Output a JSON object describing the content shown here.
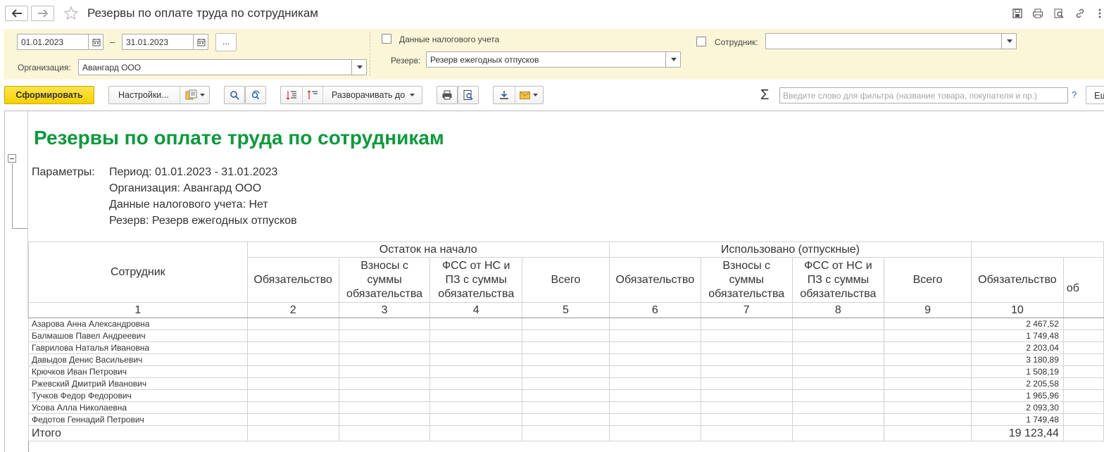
{
  "window": {
    "title": "Резервы по оплате труда по сотрудникам"
  },
  "settings": {
    "date_from": "01.01.2023",
    "date_to": "31.01.2023",
    "dash": "–",
    "dots_label": "...",
    "org_label": "Организация:",
    "org_value": "Авангард ООО",
    "tax_label": "Данные налогового учета",
    "tax_checked": false,
    "reserve_label": "Резерв:",
    "reserve_value": "Резерв ежегодных отпусков",
    "employee_label": "Сотрудник:",
    "employee_value": "",
    "employee_checked": false
  },
  "toolbar": {
    "generate": "Сформировать",
    "settings": "Настройки...",
    "expand": "Разворачивать до",
    "sigma": "Σ",
    "filter_placeholder": "Введите слово для фильтра (название товара, покупателя и пр.)",
    "help": "?",
    "eq": "Еще"
  },
  "report": {
    "title": "Резервы по оплате труда по сотрудникам",
    "params_label": "Параметры:",
    "params": [
      "Период: 01.01.2023 - 31.01.2023",
      "Организация: Авангард ООО",
      "Данные налогового учета: Нет",
      "Резерв: Резерв ежегодных отпусков"
    ],
    "columns": {
      "employee": "Сотрудник",
      "group1": "Остаток на начало",
      "group2": "Использовано (отпускные)",
      "group3": "",
      "sub": [
        "Обязательство",
        "Взносы с суммы обязательства",
        "ФСС от НС и ПЗ с суммы обязательства",
        "Всего",
        "Обязательство",
        "Взносы с суммы обязательства",
        "ФСС от НС и ПЗ с суммы обязательства",
        "Всего",
        "Обязательство",
        "об"
      ],
      "numbers": [
        "1",
        "2",
        "3",
        "4",
        "5",
        "6",
        "7",
        "8",
        "9",
        "10",
        ""
      ]
    },
    "rows": [
      {
        "name": "Азарова Анна Александровна",
        "c10": "2 467,52"
      },
      {
        "name": "Балмашов Павел Андреевич",
        "c10": "1 749,48"
      },
      {
        "name": "Гаврилова Наталья Ивановна",
        "c10": "2 203,04"
      },
      {
        "name": "Давыдов Денис Васильевич",
        "c10": "3 180,89"
      },
      {
        "name": "Крючков Иван Петрович",
        "c10": "1 508,19"
      },
      {
        "name": "Ржевский Дмитрий Иванович",
        "c10": "2 205,58"
      },
      {
        "name": "Тучков Федор Федорович",
        "c10": "1 965,96"
      },
      {
        "name": "Усова Алла Николаевна",
        "c10": "2 093,30"
      },
      {
        "name": "Федотов Геннадий Петрович",
        "c10": "1 749,48"
      }
    ],
    "total": {
      "name": "Итого",
      "c10": "19 123,44"
    }
  }
}
